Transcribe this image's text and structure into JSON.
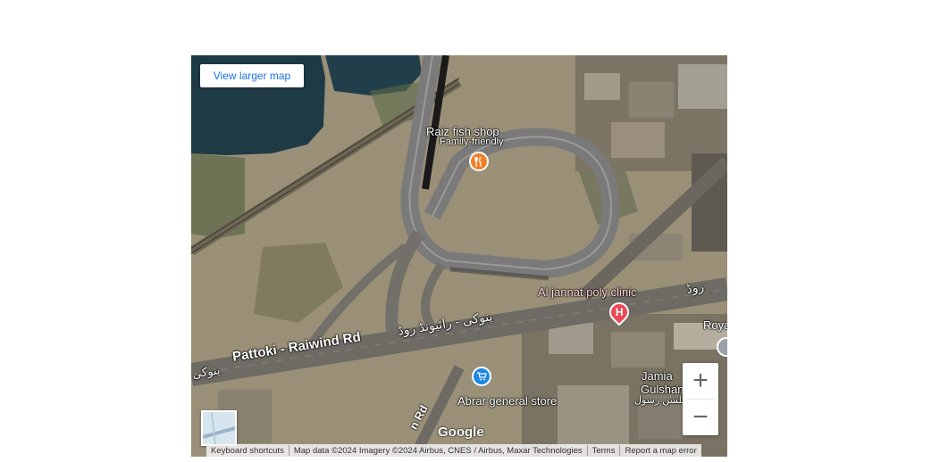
{
  "map": {
    "larger_map_link": "View larger map",
    "roads": {
      "main_road_en": "Pattoki - Raiwind Rd",
      "main_road_ur_left": "پتوکی - رائیونڈ روڈ",
      "main_road_ur_right": "روڈ",
      "main_road_ur_far_left": "پتوکی",
      "side_road_fragment": "n Rd"
    },
    "places": [
      {
        "name": "Raiz fish shop",
        "subtitle": "Family-friendly",
        "icon": "restaurant-icon",
        "color": "#f07f27"
      },
      {
        "name": "Al jannat poly clinic",
        "icon": "hospital-icon",
        "color": "#ea4a55"
      },
      {
        "name": "Abrar general store",
        "icon": "shopping-cart-icon",
        "color": "#1e88e5"
      },
      {
        "name": "Jamia",
        "subtitle_en": "Gulshan",
        "subtitle_ur": "گلشن رسول",
        "icon": "",
        "color": ""
      },
      {
        "name": "Roya",
        "icon": "place-icon",
        "color": "#9aa0a6"
      }
    ],
    "zoom": {
      "in": "+",
      "out": "−"
    },
    "brand": "Google",
    "attribution": {
      "keyboard": "Keyboard shortcuts",
      "data": "Map data ©2024 Imagery ©2024 Airbus, CNES / Airbus, Maxar Technologies",
      "terms": "Terms",
      "report": "Report a map error"
    }
  }
}
